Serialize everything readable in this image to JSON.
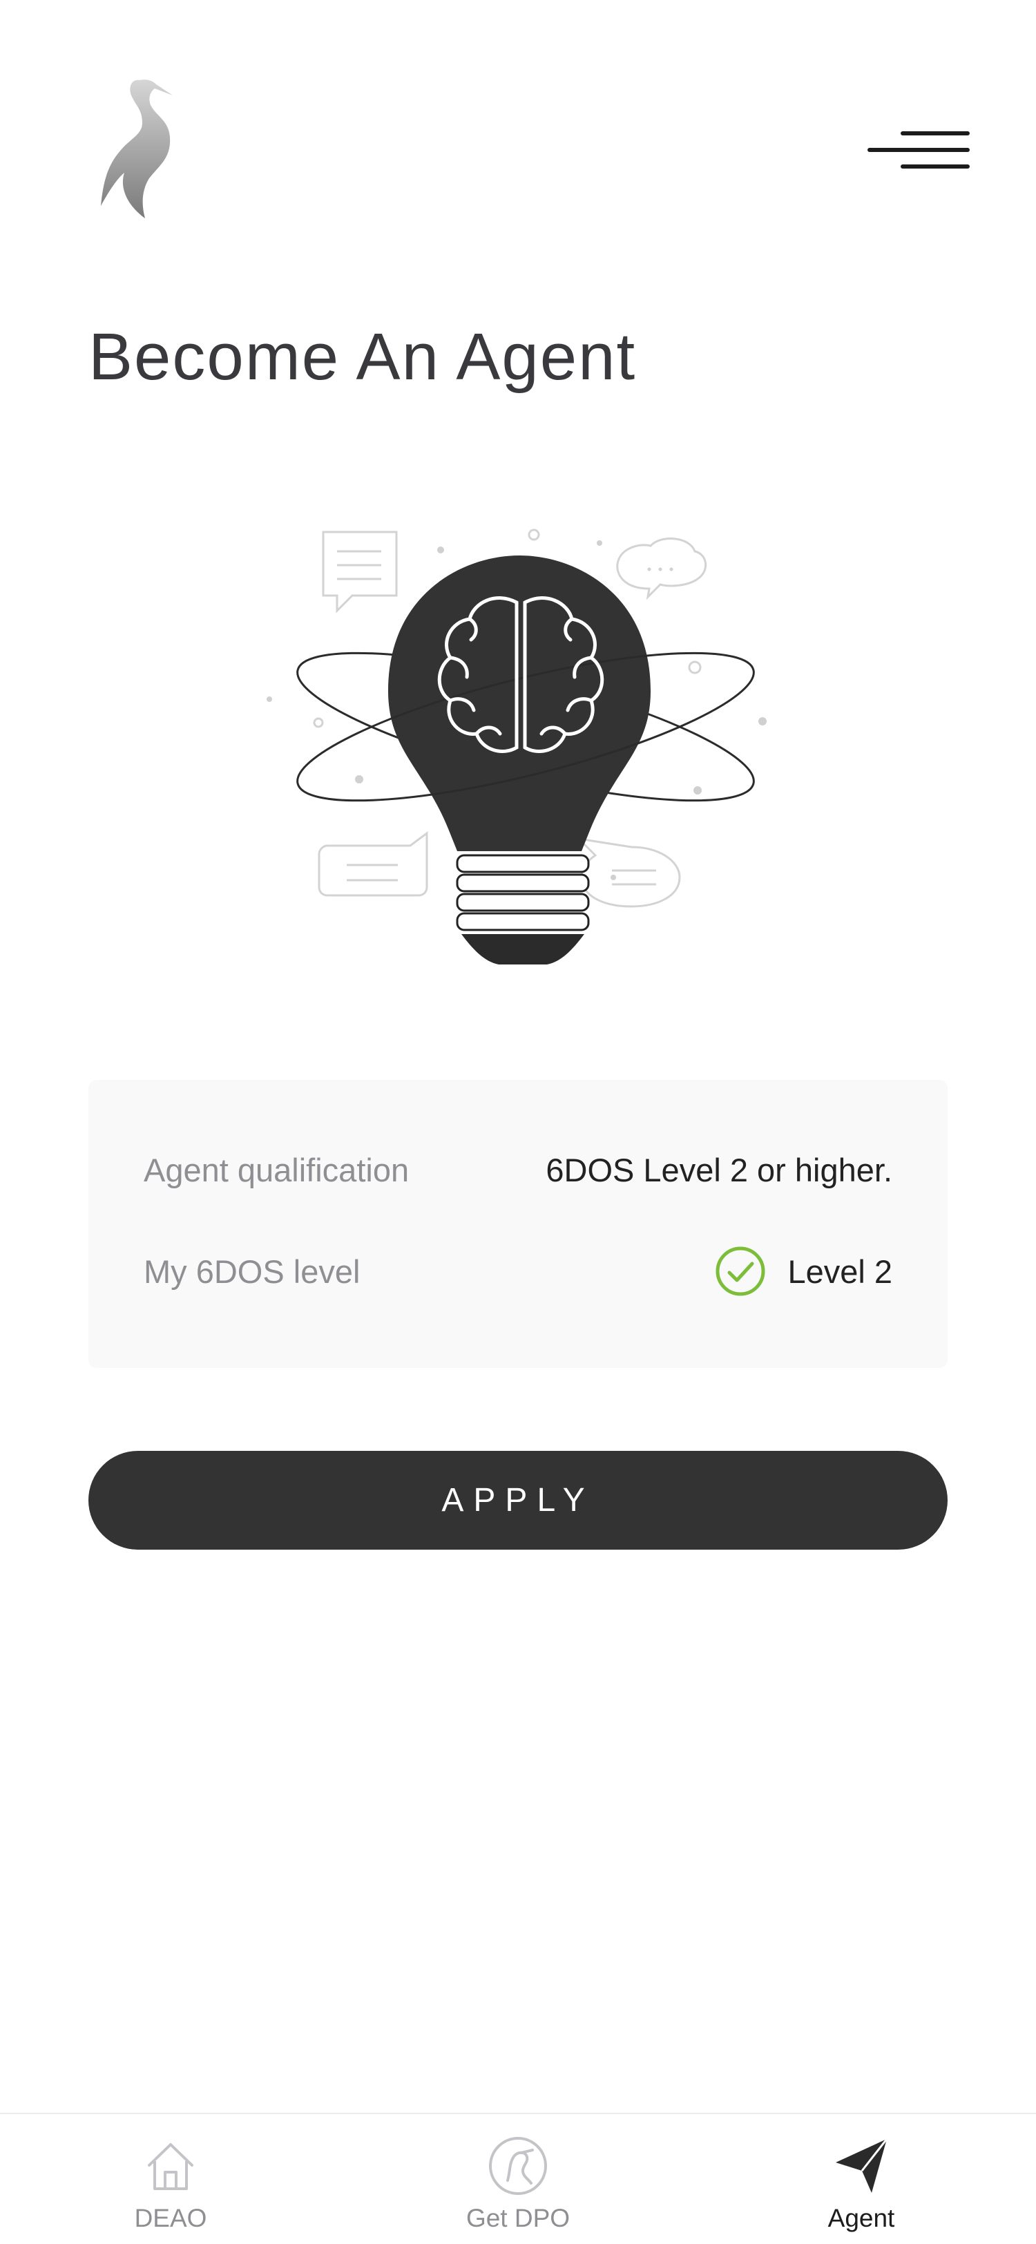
{
  "header": {
    "logo_icon": "crane-bird-logo",
    "menu_icon": "hamburger-menu-icon"
  },
  "page": {
    "title": "Become An Agent",
    "illustration_icon": "lightbulb-brain-illustration"
  },
  "qualification": {
    "agent_label": "Agent qualification",
    "agent_value": "6DOS Level 2 or higher.",
    "level_label": "My 6DOS level",
    "level_value": "Level 2",
    "level_status_icon": "check-circle-icon",
    "status_color": "#7cbe3a"
  },
  "actions": {
    "apply_label": "APPLY",
    "button_color": "#333333"
  },
  "tabbar": {
    "items": [
      {
        "label": "DEAO",
        "icon": "home-icon",
        "active": false
      },
      {
        "label": "Get DPO",
        "icon": "dpo-coin-icon",
        "active": false
      },
      {
        "label": "Agent",
        "icon": "paper-plane-icon",
        "active": true
      }
    ]
  }
}
